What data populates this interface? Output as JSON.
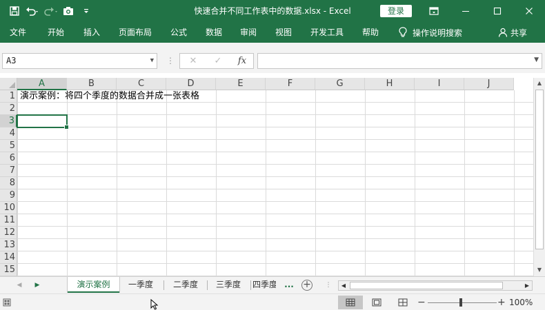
{
  "window": {
    "title": "快速合并不同工作表中的数据.xlsx  -  Excel",
    "login_label": "登录"
  },
  "ribbon": {
    "tabs": [
      "文件",
      "开始",
      "插入",
      "页面布局",
      "公式",
      "数据",
      "审阅",
      "视图",
      "开发工具",
      "帮助"
    ],
    "tell_me": "操作说明搜索",
    "share": "共享"
  },
  "formula_bar": {
    "name_box": "A3",
    "fx_label": "fx",
    "formula": ""
  },
  "grid": {
    "columns": [
      "A",
      "B",
      "C",
      "D",
      "E",
      "F",
      "G",
      "H",
      "I",
      "J"
    ],
    "rows": [
      "1",
      "2",
      "3",
      "4",
      "5",
      "6",
      "7",
      "8",
      "9",
      "10",
      "11",
      "12",
      "13",
      "14",
      "15"
    ],
    "selected_column": "A",
    "selected_row": "3",
    "cell_A1": "演示案例：将四个季度的数据合并成一张表格"
  },
  "sheets": {
    "tabs": [
      "演示案例",
      "一季度",
      "二季度",
      "三季度",
      "四季度"
    ],
    "active": "演示案例",
    "more": "..."
  },
  "status": {
    "zoom": "100%"
  },
  "colors": {
    "accent": "#217346",
    "chrome": "#f3f3f3"
  }
}
